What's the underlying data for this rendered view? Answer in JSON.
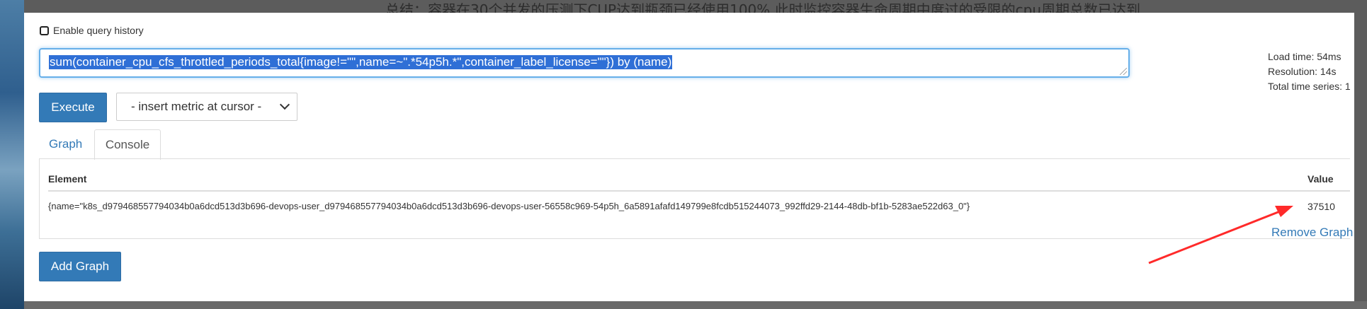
{
  "background": {
    "note_text": "总结：容器在30个并发的压测下CUP达到瓶颈已经使用100%,此时监控容器生命周期中度过的受限的cpu周期总数已达到"
  },
  "history": {
    "label": "Enable query history"
  },
  "query": {
    "expression": "sum(container_cpu_cfs_throttled_periods_total{image!=\"\",name=~\".*54p5h.*\",container_label_license=\"\"}) by (name)"
  },
  "stats": {
    "load_time": "Load time: 54ms",
    "resolution": "Resolution: 14s",
    "total_series": "Total time series: 1"
  },
  "toolbar": {
    "execute_label": "Execute",
    "metric_select": "- insert metric at cursor -"
  },
  "tabs": [
    {
      "label": "Graph",
      "active": false
    },
    {
      "label": "Console",
      "active": true
    }
  ],
  "table": {
    "headers": [
      "Element",
      "Value"
    ],
    "rows": [
      {
        "element": "{name=\"k8s_d979468557794034b0a6dcd513d3b696-devops-user_d979468557794034b0a6dcd513d3b696-devops-user-56558c969-54p5h_6a5891afafd149799e8fcdb515244073_992ffd29-2144-48db-bf1b-5283ae522d63_0\"}",
        "value": "37510"
      }
    ]
  },
  "actions": {
    "remove_graph": "Remove Graph",
    "add_graph": "Add Graph"
  },
  "colors": {
    "primary": "#337ab7",
    "annotation_arrow": "#ff2a2a",
    "selection": "#2f6fd6"
  }
}
